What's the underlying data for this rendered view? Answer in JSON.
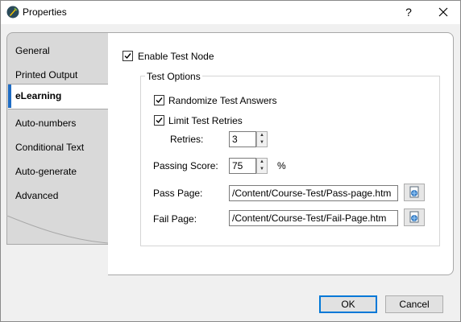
{
  "window": {
    "title": "Properties",
    "help_label": "?"
  },
  "nav": {
    "items": [
      {
        "label": "General"
      },
      {
        "label": "Printed Output"
      },
      {
        "label": "eLearning"
      },
      {
        "label": "Auto-numbers"
      },
      {
        "label": "Conditional Text"
      },
      {
        "label": "Auto-generate"
      },
      {
        "label": "Advanced"
      }
    ],
    "selected_index": 2,
    "accent_color": "#1e6cc4"
  },
  "content": {
    "enable_test_node": {
      "label": "Enable Test Node",
      "checked": true
    },
    "test_options": {
      "title": "Test Options",
      "randomize": {
        "label": "Randomize Test Answers",
        "checked": true
      },
      "limit_retries": {
        "label": "Limit Test Retries",
        "checked": true
      },
      "retries": {
        "label": "Retries:",
        "value": "3"
      },
      "passing_score": {
        "label": "Passing Score:",
        "value": "75",
        "unit": "%"
      },
      "pass_page": {
        "label": "Pass Page:",
        "value": "/Content/Course-Test/Pass-page.htm",
        "browse_icon": "browse-file-icon"
      },
      "fail_page": {
        "label": "Fail Page:",
        "value": "/Content/Course-Test/Fail-Page.htm",
        "browse_icon": "browse-file-icon"
      }
    }
  },
  "footer": {
    "ok_label": "OK",
    "cancel_label": "Cancel"
  }
}
